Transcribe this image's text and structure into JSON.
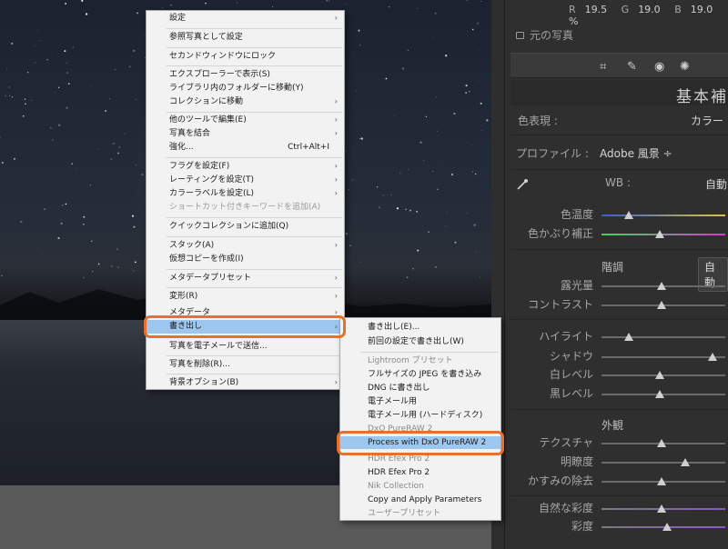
{
  "panel": {
    "rgb": {
      "r_label": "R",
      "r_value": "19.5",
      "g_label": "G",
      "g_value": "19.0",
      "b_label": "B",
      "b_value": "19.0 %"
    },
    "original_photo_label": "元の写真",
    "tool_icons": [
      "crop-icon",
      "heal-icon",
      "redeye-icon",
      "mask-icon"
    ],
    "section_title": "基本補",
    "treatment_label": "色表現 :",
    "treatment_value": "カラー",
    "profile_label": "プロファイル :",
    "profile_value": "Adobe 風景 ÷",
    "wb_label": "WB :",
    "wb_value": "自動",
    "temp_label": "色温度",
    "tint_label": "色かぶり補正",
    "tone_title": "階調",
    "tone_auto": "自動",
    "exposure_label": "露光量",
    "contrast_label": "コントラスト",
    "highlights_label": "ハイライト",
    "shadows_label": "シャドウ",
    "whites_label": "白レベル",
    "blacks_label": "黒レベル",
    "presence_title": "外観",
    "texture_label": "テクスチャ",
    "clarity_label": "明瞭度",
    "dehaze_label": "かすみの除去",
    "vibrance_label": "自然な彩度",
    "saturation_label": "彩度"
  },
  "main_menu": {
    "items": [
      {
        "label": "設定",
        "arrow": "›"
      },
      {
        "label": "参照写真として設定"
      },
      {
        "label": "セカンドウィンドウにロック"
      },
      {
        "label": "エクスプローラーで表示(S)"
      },
      {
        "label": "ライブラリ内のフォルダーに移動(Y)"
      },
      {
        "label": "コレクションに移動",
        "arrow": "›"
      },
      {
        "label": "他のツールで編集(E)",
        "arrow": "›"
      },
      {
        "label": "写真を結合",
        "arrow": "›"
      },
      {
        "label": "強化...",
        "shortcut": "Ctrl+Alt+I"
      },
      {
        "label": "フラグを設定(F)",
        "arrow": "›"
      },
      {
        "label": "レーティングを設定(T)",
        "arrow": "›"
      },
      {
        "label": "カラーラベルを設定(L)",
        "arrow": "›"
      },
      {
        "label": "ショートカット付きキーワードを追加(A)"
      },
      {
        "label": "クイックコレクションに追加(Q)"
      },
      {
        "label": "スタック(A)",
        "arrow": "›"
      },
      {
        "label": "仮想コピーを作成(I)"
      },
      {
        "label": "メタデータプリセット",
        "arrow": "›"
      },
      {
        "label": "変形(R)",
        "arrow": "›"
      },
      {
        "label": "メタデータ",
        "arrow": "›"
      },
      {
        "label": "書き出し",
        "arrow": "›"
      },
      {
        "label": "写真を電子メールで送信..."
      },
      {
        "label": "写真を削除(R)..."
      },
      {
        "label": "背景オプション(B)",
        "arrow": "›"
      }
    ]
  },
  "sub_menu": {
    "items": [
      {
        "label": "書き出し(E)..."
      },
      {
        "label": "前回の設定で書き出し(W)"
      },
      {
        "label": "Lightroom プリセット"
      },
      {
        "label": "フルサイズの JPEG を書き込み"
      },
      {
        "label": "DNG に書き出し"
      },
      {
        "label": "電子メール用"
      },
      {
        "label": "電子メール用 (ハードディスク)"
      },
      {
        "label": "DxO PureRAW 2"
      },
      {
        "label": "Process with DxO PureRAW 2"
      },
      {
        "label": "HDR Efex Pro 2"
      },
      {
        "label": "HDR Efex Pro 2"
      },
      {
        "label": "Nik Collection"
      },
      {
        "label": "Copy and Apply Parameters"
      },
      {
        "label": "ユーザープリセット"
      }
    ]
  },
  "colors": {
    "highlight": "#e8702a",
    "selection": "#9ec7ef",
    "panel_bg": "#2f2f2f"
  }
}
